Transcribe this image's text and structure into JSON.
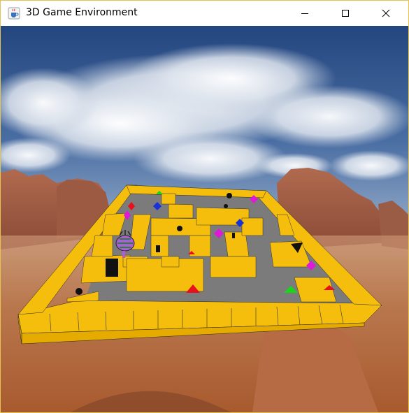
{
  "window": {
    "title": "3D Game Environment",
    "app_icon": "java-coffee-cup-icon",
    "controls": [
      "minimize-icon",
      "maximize-icon",
      "close-icon"
    ]
  },
  "scene": {
    "description_items": [
      "sky",
      "clouds",
      "desert-mesas",
      "yellow-maze",
      "gray-floor",
      "pacman-player",
      "ghost-enemies",
      "pyramid-pickups",
      "diamond-pickups"
    ],
    "colors": {
      "wall": "#f5be0c",
      "wall_side": "#e0a800",
      "floor": "#7c7c7c",
      "sky_top": "#2c4f8a",
      "sky_bottom": "#9fb4cf",
      "desert": "#b86a3c",
      "pickup_red": "#e8101a",
      "pickup_green": "#19d61a",
      "pickup_magenta": "#e018d8",
      "pickup_blue": "#1832d8",
      "player": "#b05adc"
    }
  }
}
